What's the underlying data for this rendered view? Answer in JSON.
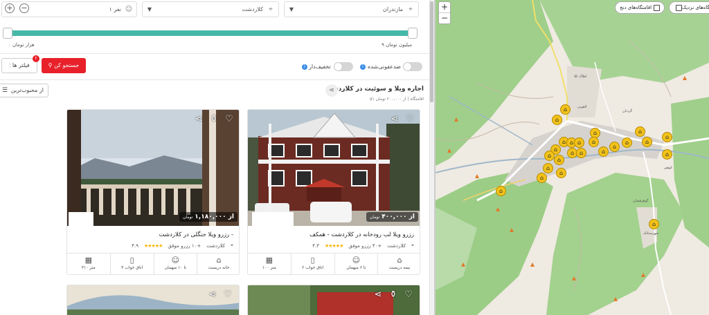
{
  "filters": {
    "province": "مازندران",
    "city": "کلاردشت",
    "guests": "۱ نفر",
    "range_max": "۹ میلیون تومان",
    "range_min": "۰ هزار تومان",
    "toggle_discount": "تخفیف‌دار",
    "toggle_weak": "ضدعفونی‌شده",
    "search_label": "جستجو کن",
    "filters_label": "فیلتر ها",
    "filters_badge": "۲"
  },
  "listing_header": {
    "title": "اجاره ویلا و سوئیت در کلاردشت",
    "subtitle": "۵۱ اقامتگاه | از ۲۰۰,۰۰۰ تومان",
    "sort_label": "از محبوب‌ترین"
  },
  "cards": [
    {
      "price": "از ۴۰۰,۰۰۰",
      "price_unit": "تومان",
      "title": "رزرو ویلا لب رودخانه در کلاردشت - همکف",
      "location": "کلاردشت",
      "success": "+۴۰ رزرو موفق",
      "rating": "۴.۳",
      "stars": "★★★★★",
      "features": [
        {
          "icon": "home-icon",
          "glyph": "⌂",
          "label": "نیمه دربست"
        },
        {
          "icon": "guests-icon",
          "glyph": "☺",
          "label": "تا ۶ میهمان"
        },
        {
          "icon": "door-icon",
          "glyph": "▯",
          "label": "۲ اتاق خواب"
        },
        {
          "icon": "area-icon",
          "glyph": "▦",
          "label": "۱۰۰ متر"
        }
      ]
    },
    {
      "price": "از ۱,۱۸۰,۰۰۰",
      "price_unit": "تومان",
      "title": "رزرو ویلا جنگلی در کلاردشت -",
      "location": "کلاردشت",
      "success": "+۱۰ رزرو موفق",
      "rating": "۴.۹",
      "stars": "★★★★★",
      "features": [
        {
          "icon": "home-icon",
          "glyph": "⌂",
          "label": "خانه دربست"
        },
        {
          "icon": "guests-icon",
          "glyph": "☺",
          "label": "تا ۱۰ میهمان"
        },
        {
          "icon": "door-icon",
          "glyph": "▯",
          "label": "۳ اتاق خواب"
        },
        {
          "icon": "area-icon",
          "glyph": "▦",
          "label": "۳۱۰ متر"
        }
      ]
    }
  ],
  "map": {
    "nearby_label": "اقامتگاه‌های نزدیک",
    "pan_label": "اقامتگاه‌های دنج",
    "zoom_in": "+",
    "zoom_out": "−",
    "pin_count": 24
  }
}
